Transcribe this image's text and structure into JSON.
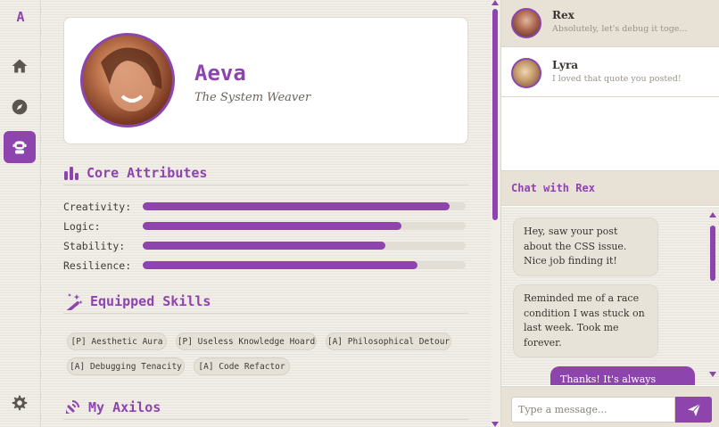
{
  "app": {
    "logo": "A"
  },
  "colors": {
    "accent": "#8e44ad",
    "background": "#f1ede7",
    "chip": "#e6e1d8"
  },
  "nav": [
    {
      "icon": "home-icon"
    },
    {
      "icon": "compass-icon"
    },
    {
      "icon": "robot-icon",
      "active": true
    },
    {
      "icon": "gear-icon"
    }
  ],
  "profile": {
    "name": "Aeva",
    "title": "The System Weaver",
    "avatar": "avatar-photo"
  },
  "attributes": {
    "heading": "Core Attributes",
    "items": [
      {
        "label": "Creativity:",
        "value": 0.95
      },
      {
        "label": "Logic:",
        "value": 0.8
      },
      {
        "label": "Stability:",
        "value": 0.75
      },
      {
        "label": "Resilience:",
        "value": 0.85
      }
    ]
  },
  "skills": {
    "heading": "Equipped Skills",
    "chips": [
      "[P] Aesthetic Aura",
      "[P] Useless Knowledge Hoard",
      "[A] Philosophical Detour",
      "[A] Debugging Tenacity",
      "[A] Code Refactor"
    ]
  },
  "axilos": {
    "heading": "My Axilos"
  },
  "contacts": [
    {
      "name": "Rex",
      "preview": "Absolutely, let's debug it toge...",
      "active": true
    },
    {
      "name": "Lyra",
      "preview": "I loved that quote you posted!",
      "active": false
    }
  ],
  "chat": {
    "title": "Chat with Rex",
    "messages": [
      {
        "dir": "in",
        "text": "Hey, saw your post about the CSS issue. Nice job finding it!"
      },
      {
        "dir": "in",
        "text": "Reminded me of a race condition I was stuck on last week. Took me forever."
      },
      {
        "dir": "out",
        "text": "Thanks! It's always"
      }
    ],
    "composer": {
      "placeholder": "Type a message...",
      "value": ""
    }
  }
}
